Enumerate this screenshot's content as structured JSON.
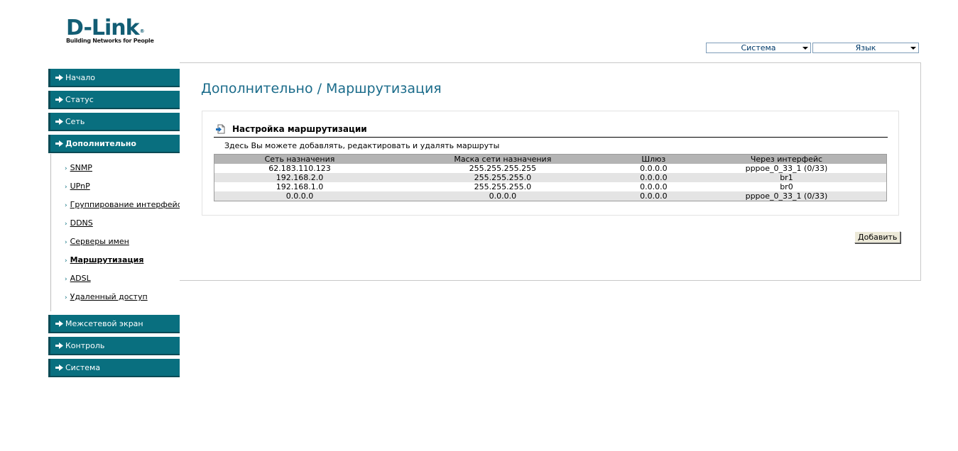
{
  "brand": {
    "name": "D-Link",
    "registered": "®",
    "tagline": "Building Networks for People",
    "color": "#125d74"
  },
  "top_selects": {
    "system": "Система",
    "language": "Язык"
  },
  "sidebar": {
    "items": [
      {
        "label": "Начало",
        "icon": "arrow-right-icon"
      },
      {
        "label": "Статус",
        "icon": "arrow-right-icon"
      },
      {
        "label": "Сеть",
        "icon": "arrow-right-icon"
      },
      {
        "label": "Дополнительно",
        "icon": "arrow-down-icon",
        "active": true
      },
      {
        "label": "Межсетевой экран",
        "icon": "arrow-right-icon"
      },
      {
        "label": "Контроль",
        "icon": "arrow-right-icon"
      },
      {
        "label": "Система",
        "icon": "arrow-right-icon"
      }
    ],
    "submenu": [
      {
        "label": "SNMP"
      },
      {
        "label": "UPnP"
      },
      {
        "label": "Группирование интерфейсов"
      },
      {
        "label": "DDNS"
      },
      {
        "label": "Серверы имен"
      },
      {
        "label": "Маршрутизация",
        "active": true
      },
      {
        "label": "ADSL"
      },
      {
        "label": "Удаленный доступ"
      }
    ],
    "accent_color": "#096f7f"
  },
  "main": {
    "title": "Дополнительно /  Маршрутизация",
    "section": {
      "title": "Настройка маршрутизации",
      "description": "Здесь Вы можете добавлять, редактировать и удалять маршруты",
      "table": {
        "headers": [
          "Сеть назначения",
          "Маска сети назначения",
          "Шлюз",
          "Через интерфейс"
        ],
        "rows": [
          [
            "62.183.110.123",
            "255.255.255.255",
            "0.0.0.0",
            "pppoe_0_33_1 (0/33)"
          ],
          [
            "192.168.2.0",
            "255.255.255.0",
            "0.0.0.0",
            "br1"
          ],
          [
            "192.168.1.0",
            "255.255.255.0",
            "0.0.0.0",
            "br0"
          ],
          [
            "0.0.0.0",
            "0.0.0.0",
            "0.0.0.0",
            "pppoe_0_33_1 (0/33)"
          ]
        ]
      }
    },
    "add_button": "Добавить"
  }
}
